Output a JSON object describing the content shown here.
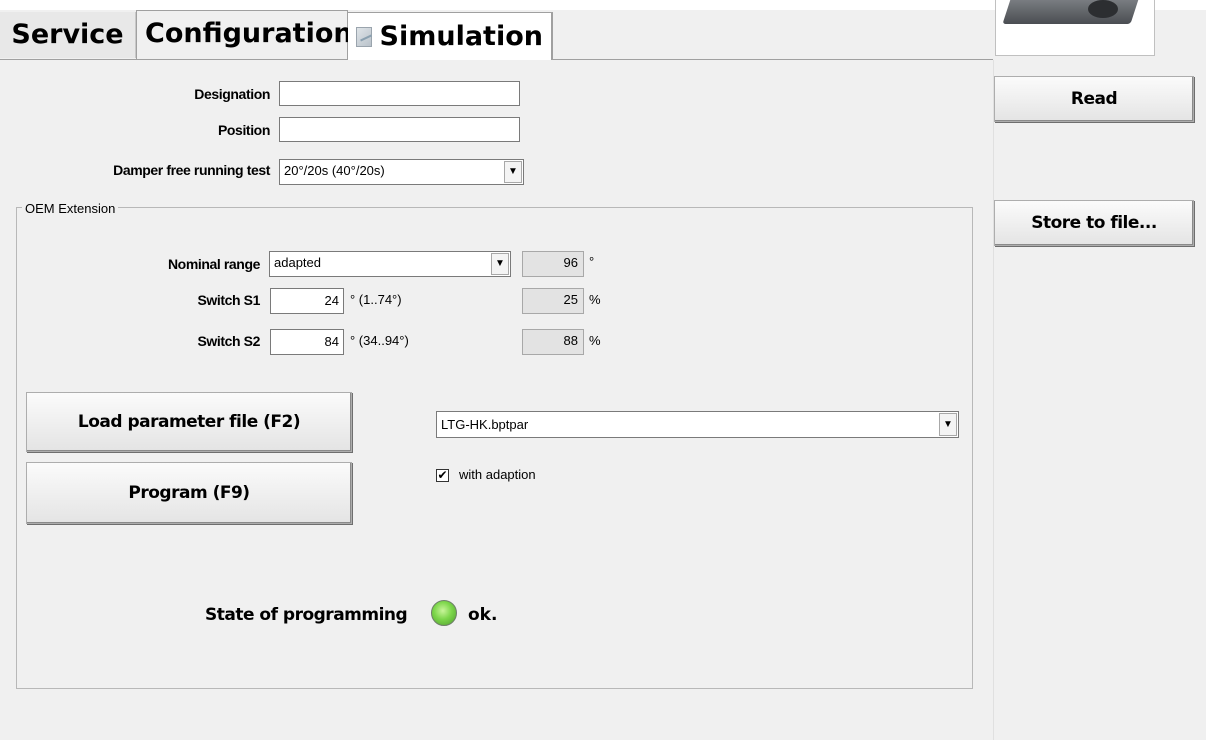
{
  "tabs": [
    {
      "label": "Service"
    },
    {
      "label": "Configuration"
    },
    {
      "label": "Simulation",
      "icon": "simulation-icon"
    }
  ],
  "fields": {
    "designation_label": "Designation",
    "designation_value": "",
    "position_label": "Position",
    "position_value": "",
    "damper_label": "Damper free running test",
    "damper_value": "20°/20s (40°/20s)"
  },
  "oem": {
    "title": "OEM Extension",
    "nominal_label": "Nominal range",
    "nominal_value": "adapted",
    "nominal_readout": "96",
    "nominal_unit": "°",
    "s1_label": "Switch S1",
    "s1_value": "24",
    "s1_range": "° (1..74°)",
    "s1_readout": "25",
    "s1_unit": "%",
    "s2_label": "Switch S2",
    "s2_value": "84",
    "s2_range": "° (34..94°)",
    "s2_readout": "88",
    "s2_unit": "%",
    "load_button": "Load parameter file (F2)",
    "program_button": "Program (F9)",
    "param_file": "LTG-HK.bptpar",
    "with_adaption_label": "with adaption",
    "with_adaption_checked": true,
    "state_label": "State of programming",
    "state_value": "ok.",
    "state_color": "#7cd64a"
  },
  "side": {
    "read_button": "Read",
    "store_button": "Store to file..."
  },
  "icons": {
    "check": "✔",
    "dropdown": "▼"
  }
}
